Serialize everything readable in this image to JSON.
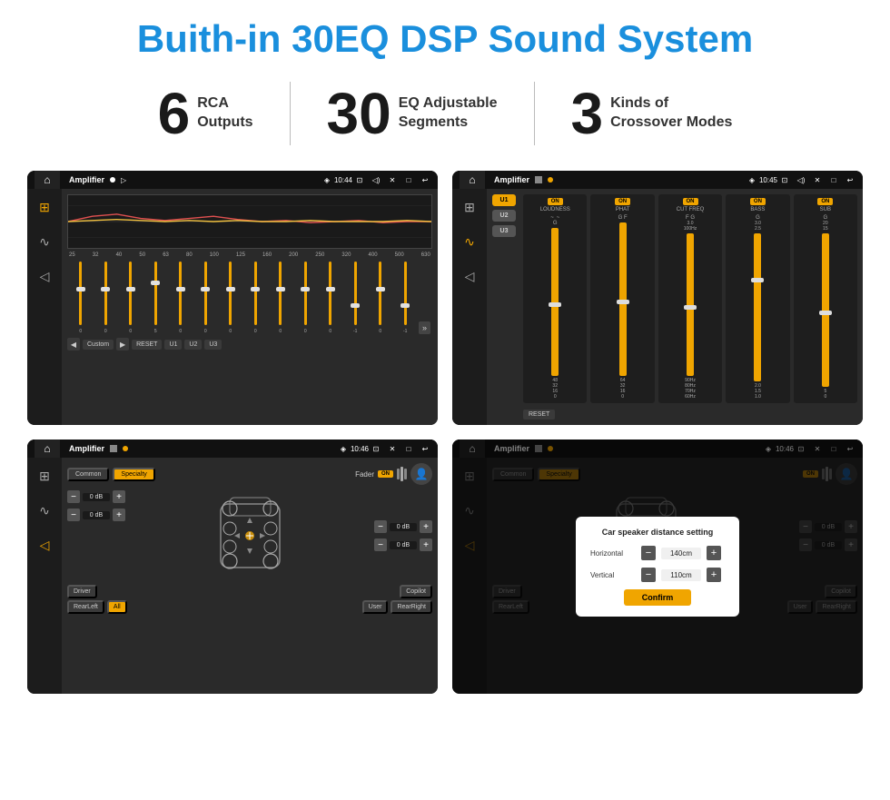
{
  "page": {
    "title": "Buith-in 30EQ DSP Sound System"
  },
  "stats": [
    {
      "number": "6",
      "label": "RCA\nOutputs"
    },
    {
      "number": "30",
      "label": "EQ Adjustable\nSegments"
    },
    {
      "number": "3",
      "label": "Kinds of\nCrossover Modes"
    }
  ],
  "screen_tl": {
    "app_name": "Amplifier",
    "time": "10:44",
    "freq_labels": [
      "25",
      "32",
      "40",
      "50",
      "63",
      "80",
      "100",
      "125",
      "160",
      "200",
      "250",
      "320",
      "400",
      "500",
      "630"
    ],
    "eq_values": [
      "0",
      "0",
      "0",
      "5",
      "0",
      "0",
      "0",
      "0",
      "0",
      "0",
      "0",
      "-1",
      "0",
      "-1"
    ],
    "buttons": [
      "Custom",
      "RESET",
      "U1",
      "U2",
      "U3"
    ]
  },
  "screen_tr": {
    "app_name": "Amplifier",
    "time": "10:45",
    "presets": [
      "U1",
      "U2",
      "U3"
    ],
    "channels": [
      {
        "label": "LOUDNESS",
        "on": true
      },
      {
        "label": "PHAT",
        "on": true
      },
      {
        "label": "CUT FREQ",
        "on": true
      },
      {
        "label": "BASS",
        "on": true
      },
      {
        "label": "SUB",
        "on": true
      }
    ],
    "reset_label": "RESET"
  },
  "screen_bl": {
    "app_name": "Amplifier",
    "time": "10:46",
    "tabs": [
      "Common",
      "Specialty"
    ],
    "fader_label": "Fader",
    "on_label": "ON",
    "db_values": [
      "0 dB",
      "0 dB",
      "0 dB",
      "0 dB"
    ],
    "nav_buttons": [
      "Driver",
      "RearLeft",
      "All",
      "RearRight",
      "Copilot",
      "User"
    ]
  },
  "screen_br": {
    "app_name": "Amplifier",
    "time": "10:46",
    "tabs": [
      "Common",
      "Specialty"
    ],
    "on_label": "ON",
    "dialog": {
      "title": "Car speaker distance setting",
      "horizontal_label": "Horizontal",
      "horizontal_value": "140cm",
      "vertical_label": "Vertical",
      "vertical_value": "110cm",
      "confirm_label": "Confirm"
    },
    "db_values": [
      "0 dB",
      "0 dB"
    ],
    "nav_buttons": [
      "Driver",
      "RearLeft",
      "User",
      "RearRight",
      "Copilot"
    ]
  },
  "icons": {
    "home": "⌂",
    "eq": "≡",
    "wave": "∿",
    "speaker": "◁",
    "location": "◈",
    "camera": "⊡",
    "volume": "◁",
    "close": "✕",
    "window": "□",
    "back": "↩",
    "play": "▶",
    "prev": "◀",
    "next": "▶",
    "settings": "⚙",
    "user": "👤",
    "tune": "⊞",
    "music": "♪"
  }
}
